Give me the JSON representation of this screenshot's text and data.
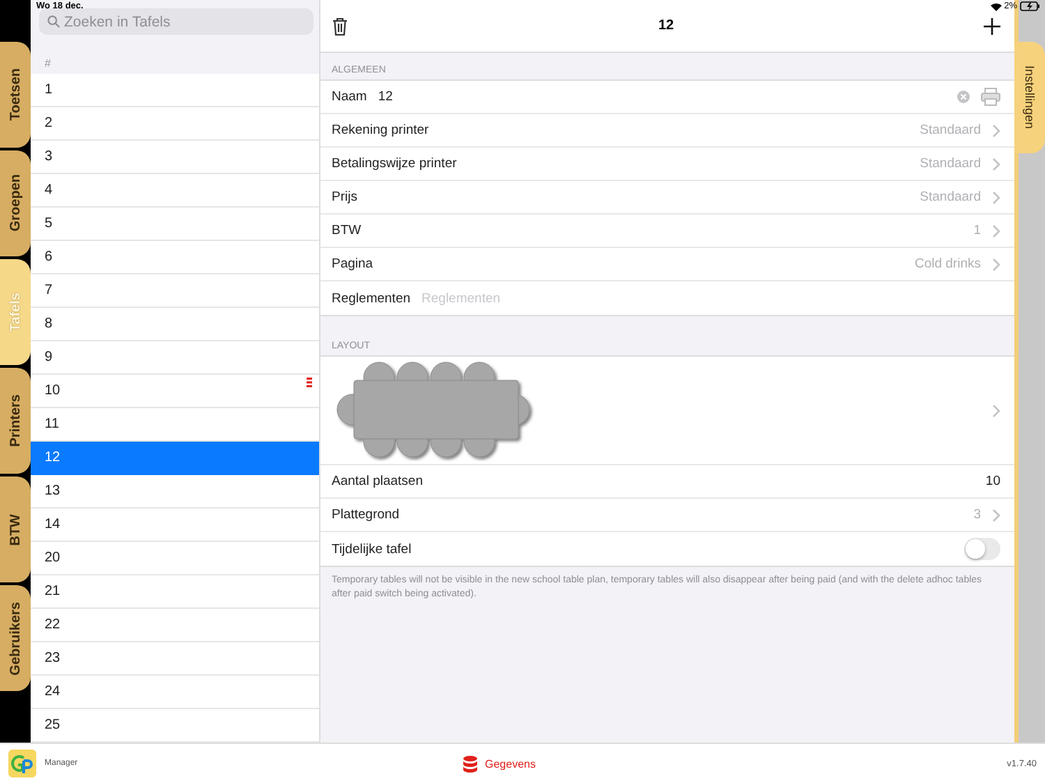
{
  "status_bar": {
    "time": "Wo 18 dec.",
    "battery": "2%"
  },
  "side_tabs": [
    {
      "label": "Toetsen",
      "selected": false
    },
    {
      "label": "Groepen",
      "selected": false
    },
    {
      "label": "Tafels",
      "selected": true
    },
    {
      "label": "Printers",
      "selected": false
    },
    {
      "label": "BTW",
      "selected": false
    },
    {
      "label": "Gebruikers",
      "selected": false
    }
  ],
  "list": {
    "search": {
      "placeholder": "Zoeken in Tafels"
    },
    "column_header": "#",
    "rows": [
      {
        "label": "1",
        "selected": false,
        "flagged": false
      },
      {
        "label": "2",
        "selected": false,
        "flagged": false
      },
      {
        "label": "3",
        "selected": false,
        "flagged": false
      },
      {
        "label": "4",
        "selected": false,
        "flagged": false
      },
      {
        "label": "5",
        "selected": false,
        "flagged": false
      },
      {
        "label": "6",
        "selected": false,
        "flagged": false
      },
      {
        "label": "7",
        "selected": false,
        "flagged": false
      },
      {
        "label": "8",
        "selected": false,
        "flagged": false
      },
      {
        "label": "9",
        "selected": false,
        "flagged": false
      },
      {
        "label": "10",
        "selected": false,
        "flagged": true
      },
      {
        "label": "11",
        "selected": false,
        "flagged": false
      },
      {
        "label": "12",
        "selected": true,
        "flagged": false
      },
      {
        "label": "13",
        "selected": false,
        "flagged": false
      },
      {
        "label": "14",
        "selected": false,
        "flagged": false
      },
      {
        "label": "20",
        "selected": false,
        "flagged": false
      },
      {
        "label": "21",
        "selected": false,
        "flagged": false
      },
      {
        "label": "22",
        "selected": false,
        "flagged": false
      },
      {
        "label": "23",
        "selected": false,
        "flagged": false
      },
      {
        "label": "24",
        "selected": false,
        "flagged": false
      },
      {
        "label": "25",
        "selected": false,
        "flagged": false
      }
    ]
  },
  "detail": {
    "title": "12",
    "sections": [
      {
        "header": "ALGEMEEN",
        "rows": [
          {
            "kind": "name_field",
            "label": "Naam",
            "value": "12"
          },
          {
            "kind": "link",
            "label": "Rekening printer",
            "value": "Standaard"
          },
          {
            "kind": "link",
            "label": "Betalingswijze printer",
            "value": "Standaard"
          },
          {
            "kind": "link",
            "label": "Prijs",
            "value": "Standaard"
          },
          {
            "kind": "link",
            "label": "BTW",
            "value": "1"
          },
          {
            "kind": "link",
            "label": "Pagina",
            "value": "Cold drinks"
          },
          {
            "kind": "field",
            "label": "Reglementen",
            "placeholder": "Reglementen"
          }
        ]
      },
      {
        "header": "LAYOUT",
        "rows": [
          {
            "kind": "layout"
          },
          {
            "kind": "value",
            "label": "Aantal plaatsen",
            "value": "10"
          },
          {
            "kind": "link",
            "label": "Plattegrond",
            "value": "3"
          },
          {
            "kind": "toggle",
            "label": "Tijdelijke tafel",
            "on": false
          }
        ]
      }
    ],
    "footnote": "Temporary tables will not be visible in the new school table plan, temporary tables will also disappear after being paid (and with the delete adhoc tables after paid switch being activated)."
  },
  "right_tab": {
    "label": "Instellingen"
  },
  "bottom_bar": {
    "app": "Manager",
    "section": "Gegevens",
    "version": "v1.7.40"
  }
}
